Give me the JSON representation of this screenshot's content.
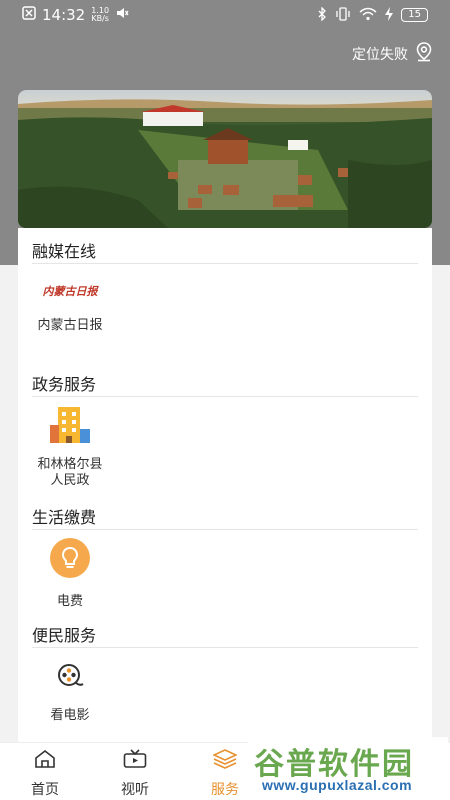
{
  "status_bar": {
    "time": "14:32",
    "speed_value": "1.10",
    "speed_unit": "KB/s",
    "battery": "15",
    "icons": [
      "notification-icon",
      "mute-icon",
      "bluetooth-icon",
      "vibrate-icon",
      "wifi-icon",
      "charging-icon"
    ]
  },
  "header": {
    "location_text": "定位失败",
    "location_icon": "location-pin-icon"
  },
  "sections": [
    {
      "title": "融媒在线",
      "items": [
        {
          "label": "内蒙古日报",
          "logo_text": "内蒙古日报",
          "icon": "newspaper-logo"
        }
      ]
    },
    {
      "title": "政务服务",
      "items": [
        {
          "label": "和林格尔县人民政",
          "icon": "building-icon"
        }
      ]
    },
    {
      "title": "生活缴费",
      "items": [
        {
          "label": "电费",
          "icon": "lightbulb-icon"
        }
      ]
    },
    {
      "title": "便民服务",
      "items": [
        {
          "label": "看电影",
          "icon": "film-reel-icon"
        }
      ]
    }
  ],
  "bottom_nav": [
    {
      "label": "首页",
      "icon": "home-icon"
    },
    {
      "label": "视听",
      "icon": "video-icon"
    },
    {
      "label": "服务",
      "icon": "layers-icon",
      "active": true
    }
  ],
  "watermark": {
    "text": "谷普软件园",
    "url": "www.gupuxlazal.com"
  },
  "colors": {
    "accent": "#e8912f",
    "header_bg": "#888888",
    "watermark_green": "#6aa84f",
    "watermark_blue": "#2b6fb3"
  }
}
